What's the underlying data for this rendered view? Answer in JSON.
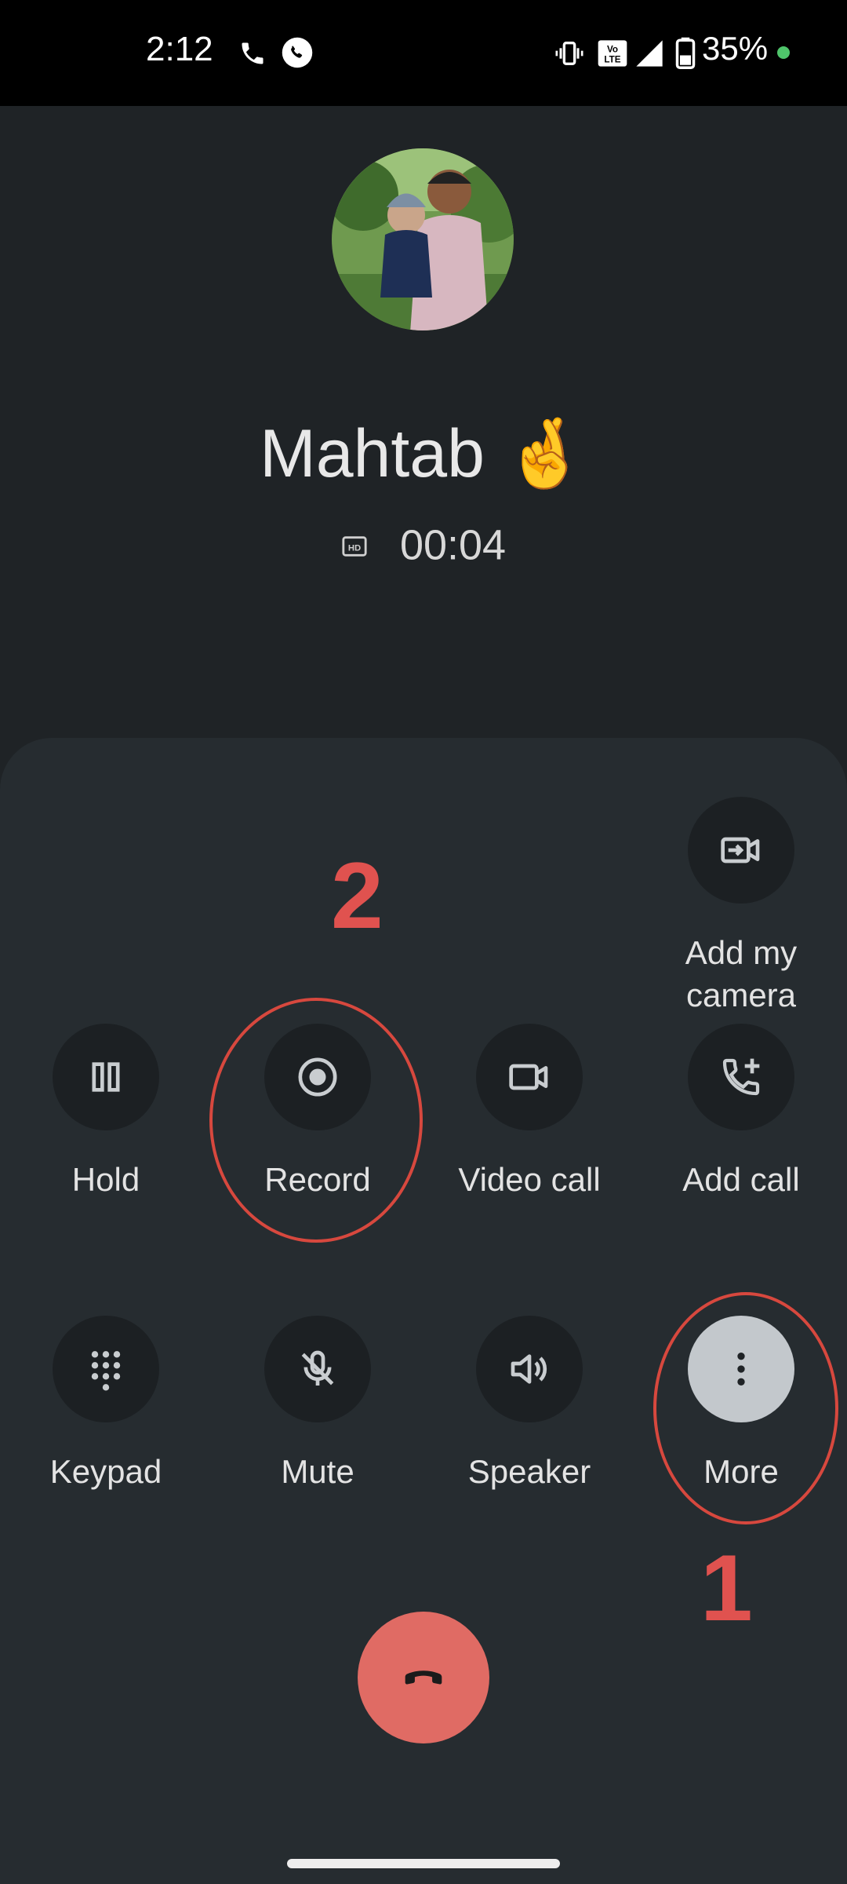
{
  "status_bar": {
    "time": "2:12",
    "battery_percent": "35%",
    "network": "VoLTE"
  },
  "contact": {
    "name": "Mahtab 🤞",
    "call_quality": "HD",
    "timer": "00:04"
  },
  "controls": {
    "add_camera": "Add my camera",
    "hold": "Hold",
    "record": "Record",
    "video_call": "Video call",
    "add_call": "Add call",
    "keypad": "Keypad",
    "mute": "Mute",
    "speaker": "Speaker",
    "more": "More"
  },
  "annotations": {
    "step_one": "1",
    "step_two": "2"
  },
  "colors": {
    "end_call": "#e06b64",
    "annotation": "#e0524f",
    "more_active": "#c3c8cc"
  }
}
